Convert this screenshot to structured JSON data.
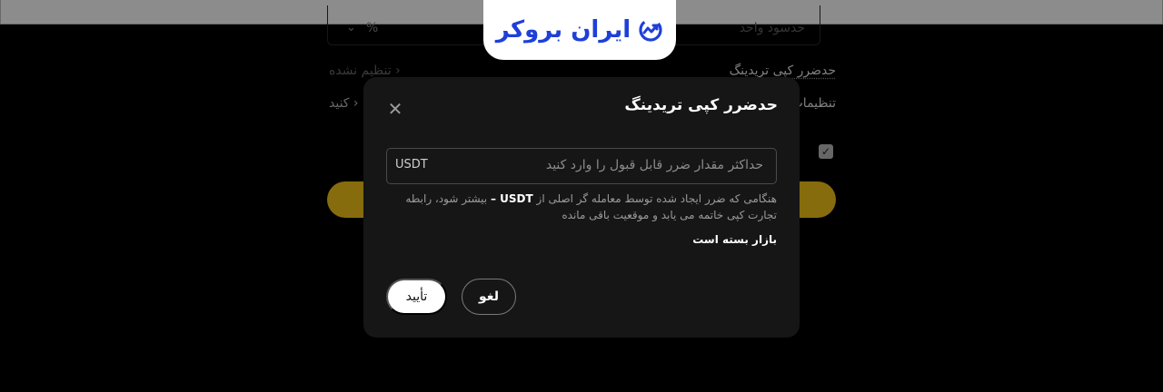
{
  "header": {
    "brand_name": "ایران بروکر",
    "brand_color": "#1e3fd8"
  },
  "background_form": {
    "limit_placeholder": "حدسود واحد",
    "limit_unit": "%",
    "stop_loss_label": "حدضرر کپی تریدینگ",
    "stop_loss_value": "تنظیم نشده",
    "settings_label": "تنظیمات",
    "settings_value": "کنید",
    "accent_color": "#f5c518"
  },
  "modal": {
    "title": "حدضرر کپی تریدینگ",
    "input_placeholder": "حداکثر مقدار ضرر قابل قبول را وارد کنید",
    "input_unit": "USDT",
    "help_before": "هنگامی که ضرر ایجاد شده توسط معامله گر اصلی از",
    "help_value": "USDT –",
    "help_after": "بیشتر شود، رابطه تجارت کپی خاتمه می یابد و موقعیت باقی مانده",
    "market_status": "بازار بسته است",
    "cancel_label": "لغو",
    "confirm_label": "تأیید"
  }
}
